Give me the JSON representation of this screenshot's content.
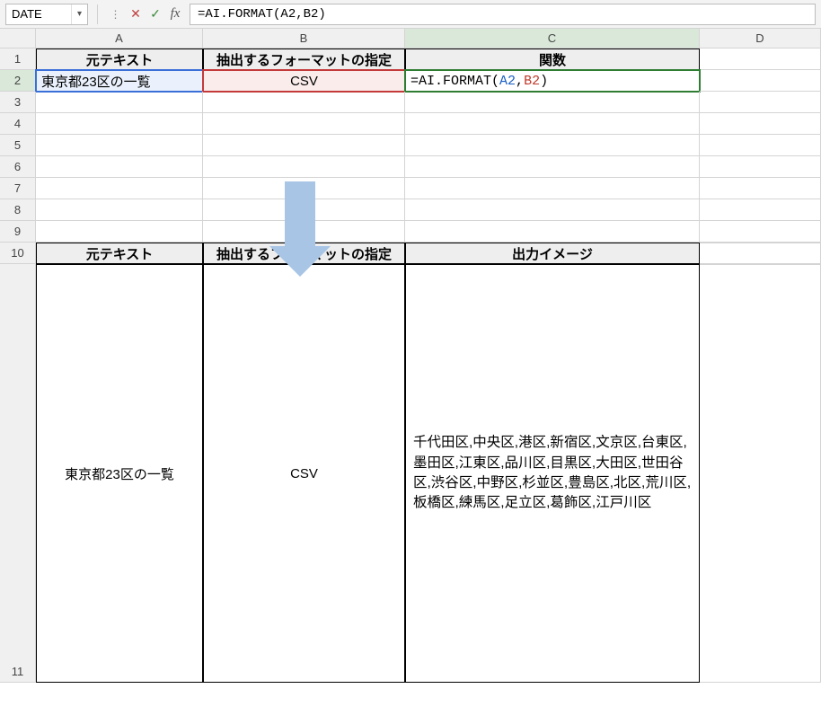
{
  "formula_bar": {
    "name_box": "DATE",
    "formula_text": "=AI.FORMAT(A2,B2)"
  },
  "columns": {
    "A": "A",
    "B": "B",
    "C": "C",
    "D": "D"
  },
  "rows": {
    "r1": "1",
    "r2": "2",
    "r3": "3",
    "r4": "4",
    "r5": "5",
    "r6": "6",
    "r7": "7",
    "r8": "8",
    "r9": "9",
    "r10": "10",
    "r11": "11"
  },
  "table1": {
    "headers": {
      "A": "元テキスト",
      "B": "抽出するフォーマットの指定",
      "C": "関数"
    },
    "row2": {
      "A": "東京都23区の一覧",
      "B": "CSV",
      "C_prefix": "=AI.FORMAT(",
      "C_arg1": "A2",
      "C_sep": ",",
      "C_arg2": "B2",
      "C_suffix": ")"
    }
  },
  "table2": {
    "headers": {
      "A": "元テキスト",
      "B": "抽出するフォーマットの指定",
      "C": "出力イメージ"
    },
    "row": {
      "A": "東京都23区の一覧",
      "B": "CSV",
      "C": "千代田区,中央区,港区,新宿区,文京区,台東区,墨田区,江東区,品川区,目黒区,大田区,世田谷区,渋谷区,中野区,杉並区,豊島区,北区,荒川区,板橋区,練馬区,足立区,葛飾区,江戸川区"
    }
  }
}
